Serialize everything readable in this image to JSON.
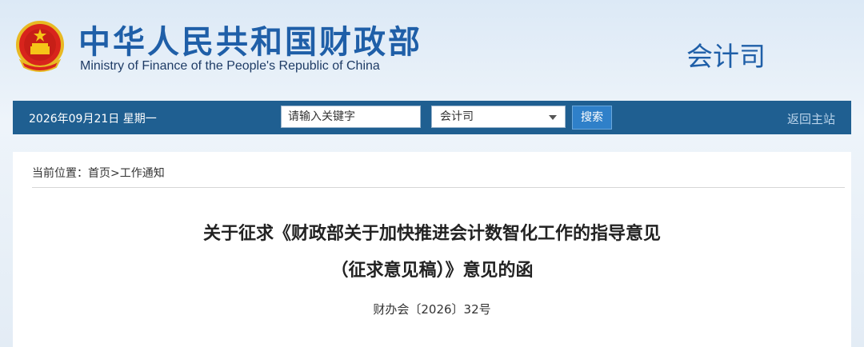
{
  "header": {
    "title_cn": "中华人民共和国财政部",
    "title_en": "Ministry of Finance of the People's Republic of China",
    "department": "会计司"
  },
  "navbar": {
    "date": "2026年09月21日  星期一",
    "search_value": "请输入关键字",
    "scope_selected": "会计司",
    "search_button": "搜索",
    "home_link": "返回主站"
  },
  "content": {
    "breadcrumb": "当前位置：首页>工作通知",
    "title_line1": "关于征求《财政部关于加快推进会计数智化工作的指导意见",
    "title_line2": "（征求意见稿）》意见的函",
    "doc_number": "财办会〔2026〕32号"
  },
  "colors": {
    "brand_blue": "#1f5fa8",
    "navbar_bg": "#1f5f91",
    "button_bg": "#2f80c9"
  },
  "icons": {
    "emblem": "national-emblem-icon",
    "dropdown": "chevron-down-icon"
  }
}
